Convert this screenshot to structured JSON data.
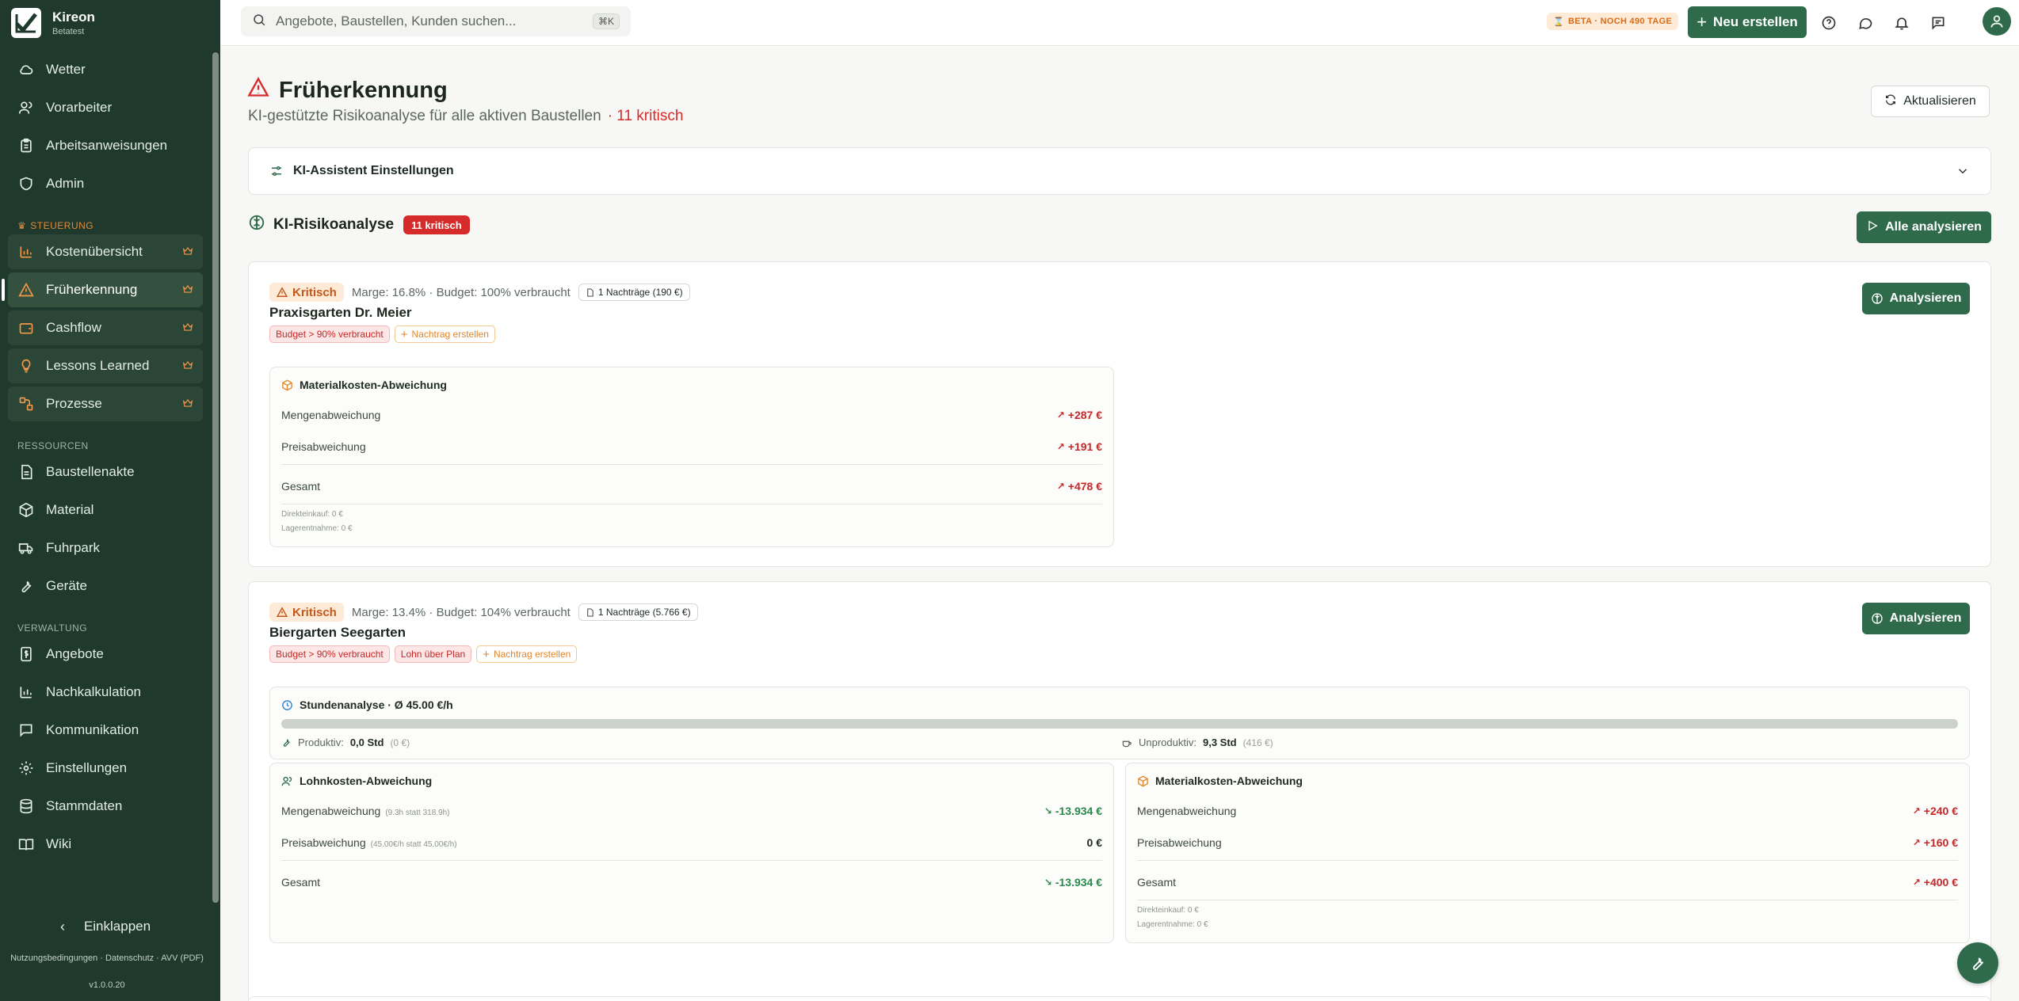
{
  "app": {
    "name": "Kireon",
    "subtitle": "Betatest"
  },
  "sidebar": {
    "top_items": [
      {
        "label": "Wetter",
        "icon": "cloud-icon"
      },
      {
        "label": "Vorarbeiter",
        "icon": "users-icon"
      },
      {
        "label": "Arbeitsanweisungen",
        "icon": "clipboard-icon"
      },
      {
        "label": "Admin",
        "icon": "shield-icon"
      }
    ],
    "sections": {
      "steuerung": "STEUERUNG",
      "ressourcen": "RESSOURCEN",
      "verwaltung": "VERWALTUNG"
    },
    "steuerung_items": [
      {
        "label": "Kostenübersicht",
        "icon": "bar-chart-icon"
      },
      {
        "label": "Früherkennung",
        "icon": "warning-icon",
        "active": true
      },
      {
        "label": "Cashflow",
        "icon": "wallet-icon"
      },
      {
        "label": "Lessons Learned",
        "icon": "lightbulb-icon"
      },
      {
        "label": "Prozesse",
        "icon": "workflow-icon"
      }
    ],
    "ressourcen_items": [
      {
        "label": "Baustellenakte",
        "icon": "file-icon"
      },
      {
        "label": "Material",
        "icon": "box-icon"
      },
      {
        "label": "Fuhrpark",
        "icon": "truck-icon"
      },
      {
        "label": "Geräte",
        "icon": "wrench-icon"
      }
    ],
    "verwaltung_items": [
      {
        "label": "Angebote",
        "icon": "invoice-icon"
      },
      {
        "label": "Nachkalkulation",
        "icon": "chart-icon"
      },
      {
        "label": "Kommunikation",
        "icon": "message-icon"
      },
      {
        "label": "Einstellungen",
        "icon": "gear-icon"
      },
      {
        "label": "Stammdaten",
        "icon": "database-icon"
      },
      {
        "label": "Wiki",
        "icon": "book-icon"
      }
    ],
    "collapse_label": "Einklappen",
    "footer_links": "Nutzungsbedingungen · Datenschutz · AVV (PDF)",
    "version": "v1.0.0.20"
  },
  "topbar": {
    "search_placeholder": "Angebote, Baustellen, Kunden suchen...",
    "shortcut": "⌘K",
    "beta_label": "BETA · NOCH 490 TAGE",
    "new_button": "Neu erstellen"
  },
  "page": {
    "title": "Früherkennung",
    "subtitle": "KI-gestützte Risikoanalyse für alle aktiven Baustellen",
    "critical_count": "· 11 kritisch",
    "refresh_button": "Aktualisieren",
    "settings_label": "KI-Assistent Einstellungen",
    "section_title": "KI-Risikoanalyse",
    "section_badge": "11 kritisch",
    "analyze_all_button": "Alle analysieren"
  },
  "cards": [
    {
      "status": "Kritisch",
      "meta": "Marge: 16.8% · Budget: 100% verbraucht",
      "nachtraege": "1 Nachträge (190 €)",
      "title": "Praxisgarten Dr. Meier",
      "tags": [
        "Budget > 90% verbraucht"
      ],
      "action_tag": "Nachtrag erstellen",
      "analyze_button": "Analysieren",
      "material": {
        "title": "Materialkosten-Abweichung",
        "menge_label": "Mengenabweichung",
        "menge_value": "+287 €",
        "preis_label": "Preisabweichung",
        "preis_value": "+191 €",
        "gesamt_label": "Gesamt",
        "gesamt_value": "+478 €",
        "direkt": "Direkteinkauf: 0 €",
        "lager": "Lagerentnahme: 0 €"
      }
    },
    {
      "status": "Kritisch",
      "meta": "Marge: 13.4% · Budget: 104% verbraucht",
      "nachtraege": "1 Nachträge (5.766 €)",
      "title": "Biergarten Seegarten",
      "tags": [
        "Budget > 90% verbraucht",
        "Lohn über Plan"
      ],
      "action_tag": "Nachtrag erstellen",
      "analyze_button": "Analysieren",
      "hours": {
        "title": "Stundenanalyse · Ø 45.00 €/h",
        "productive_fraction": 0.0,
        "produktiv_label": "Produktiv:",
        "produktiv_value": "0,0 Std",
        "produktiv_cost": "(0 €)",
        "unproduktiv_label": "Unproduktiv:",
        "unproduktiv_value": "9,3 Std",
        "unproduktiv_cost": "(416 €)"
      },
      "lohn": {
        "title": "Lohnkosten-Abweichung",
        "menge_label": "Mengenabweichung",
        "menge_note": "(9.3h statt 318.9h)",
        "menge_value": "-13.934 €",
        "preis_label": "Preisabweichung",
        "preis_note": "(45.00€/h statt 45.00€/h)",
        "preis_value": "0 €",
        "gesamt_label": "Gesamt",
        "gesamt_value": "-13.934 €"
      },
      "material": {
        "title": "Materialkosten-Abweichung",
        "menge_label": "Mengenabweichung",
        "menge_value": "+240 €",
        "preis_label": "Preisabweichung",
        "preis_value": "+160 €",
        "gesamt_label": "Gesamt",
        "gesamt_value": "+400 €",
        "direkt": "Direkteinkauf: 0 €",
        "lager": "Lagerentnahme: 0 €"
      }
    }
  ]
}
